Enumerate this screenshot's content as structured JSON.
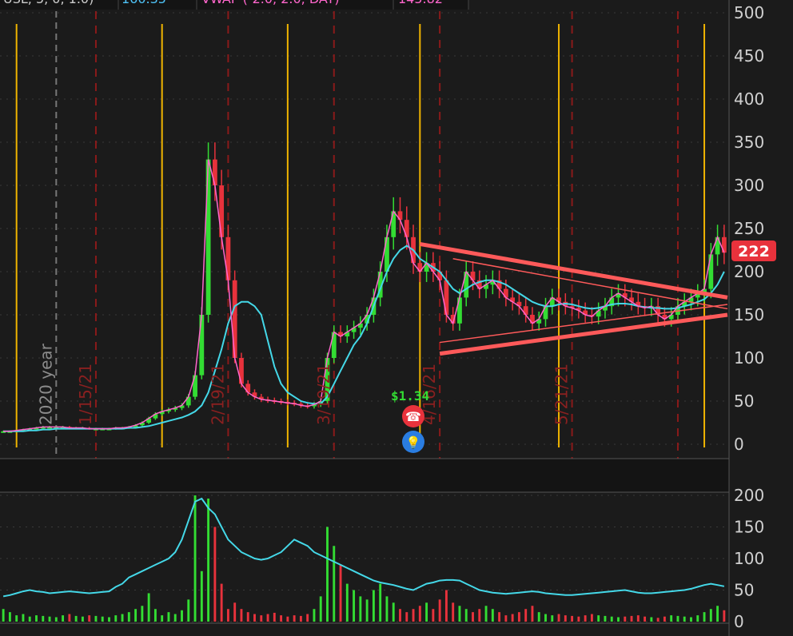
{
  "header": {
    "cells": [
      {
        "text": "USL, 5, 0, 1.0)",
        "color": "#cccccc"
      },
      {
        "text": "160.35",
        "color": "#4fc3f7"
      },
      {
        "text": "VWAP (-2.0, 2.0, DAY)",
        "color": "#ff66cc"
      },
      {
        "text": "145.82",
        "color": "#ff66cc"
      }
    ]
  },
  "price_tag": {
    "value": "222",
    "color": "#e8323c"
  },
  "events": {
    "dividend_label": "$1.34"
  },
  "colors": {
    "bg": "#1b1b1b",
    "grid": "#3a3a3a",
    "up": "#33dd33",
    "down": "#e8323c",
    "ma": "#44d8e8",
    "vwap": "#ff66cc",
    "trendline": "#ff5a5a",
    "vertical_marker": "#f0b400",
    "date_line": "#8a1a1a"
  },
  "chart_data": [
    {
      "type": "candlestick",
      "title": "",
      "ylim": [
        0,
        500
      ],
      "y_ticks": [
        0,
        50,
        100,
        150,
        200,
        250,
        300,
        350,
        400,
        450,
        500
      ],
      "date_labels": [
        "1/15/21",
        "2/19/21",
        "3/19/21",
        "4/16/21",
        "5/21/21"
      ],
      "year_label": "2020 year",
      "close": [
        15,
        15,
        16,
        17,
        18,
        19,
        20,
        20,
        20,
        20,
        19,
        19,
        19,
        18,
        18,
        18,
        18,
        19,
        19,
        20,
        22,
        25,
        30,
        35,
        38,
        40,
        42,
        45,
        55,
        80,
        150,
        330,
        300,
        240,
        190,
        100,
        70,
        60,
        55,
        52,
        51,
        50,
        49,
        48,
        47,
        45,
        44,
        46,
        50,
        100,
        130,
        125,
        130,
        135,
        140,
        150,
        170,
        200,
        240,
        270,
        260,
        240,
        210,
        200,
        210,
        200,
        190,
        150,
        140,
        170,
        200,
        190,
        180,
        185,
        190,
        180,
        170,
        165,
        160,
        150,
        140,
        145,
        160,
        170,
        165,
        160,
        158,
        155,
        150,
        148,
        155,
        160,
        170,
        175,
        170,
        165,
        160,
        158,
        160,
        150,
        145,
        150,
        160,
        165,
        170,
        175,
        180,
        220,
        240,
        222
      ],
      "ma": [
        15,
        15,
        15,
        15,
        16,
        16,
        17,
        17,
        18,
        18,
        18,
        18,
        18,
        18,
        18,
        18,
        18,
        18,
        18,
        19,
        19,
        20,
        21,
        23,
        25,
        27,
        29,
        31,
        34,
        38,
        45,
        60,
        85,
        110,
        140,
        160,
        165,
        165,
        160,
        150,
        120,
        90,
        70,
        60,
        55,
        50,
        48,
        47,
        47,
        55,
        70,
        85,
        100,
        115,
        125,
        140,
        160,
        180,
        200,
        215,
        225,
        230,
        225,
        215,
        210,
        205,
        200,
        190,
        180,
        175,
        180,
        185,
        188,
        190,
        190,
        188,
        185,
        180,
        175,
        170,
        165,
        162,
        160,
        160,
        162,
        163,
        162,
        160,
        158,
        157,
        158,
        160,
        162,
        163,
        163,
        162,
        160,
        159,
        158,
        158,
        157,
        157,
        158,
        160,
        162,
        165,
        168,
        175,
        185,
        200
      ],
      "vwap": [
        15,
        15,
        16,
        17,
        18,
        19,
        20,
        20,
        20,
        20,
        19,
        19,
        19,
        18,
        18,
        18,
        18,
        19,
        19,
        20,
        22,
        25,
        30,
        35,
        38,
        40,
        42,
        45,
        55,
        80,
        150,
        330,
        300,
        240,
        190,
        100,
        70,
        60,
        55,
        52,
        51,
        50,
        49,
        48,
        47,
        45,
        44,
        46,
        50,
        100,
        130,
        125,
        130,
        135,
        140,
        150,
        170,
        200,
        240,
        270,
        260,
        240,
        210,
        200,
        210,
        200,
        190,
        150,
        140,
        170,
        200,
        190,
        180,
        185,
        190,
        180,
        170,
        165,
        160,
        150,
        140,
        145,
        160,
        170,
        165,
        160,
        158,
        155,
        150,
        148,
        155,
        160,
        170,
        175,
        170,
        165,
        160,
        158,
        160,
        150,
        145,
        150,
        160,
        165,
        170,
        175,
        180,
        220,
        240,
        222
      ],
      "volume": [
        20,
        15,
        10,
        12,
        8,
        10,
        9,
        8,
        7,
        10,
        12,
        9,
        8,
        10,
        9,
        8,
        7,
        10,
        12,
        15,
        20,
        25,
        45,
        20,
        10,
        15,
        12,
        18,
        35,
        200,
        80,
        195,
        150,
        60,
        20,
        30,
        20,
        15,
        12,
        10,
        12,
        14,
        10,
        8,
        10,
        9,
        12,
        20,
        40,
        150,
        120,
        90,
        60,
        50,
        40,
        35,
        50,
        60,
        40,
        30,
        20,
        15,
        20,
        25,
        30,
        20,
        35,
        50,
        30,
        25,
        20,
        15,
        20,
        25,
        20,
        15,
        10,
        12,
        15,
        20,
        25,
        15,
        12,
        10,
        12,
        10,
        9,
        8,
        10,
        12,
        10,
        9,
        8,
        7,
        8,
        9,
        10,
        8,
        7,
        6,
        8,
        10,
        9,
        8,
        7,
        10,
        15,
        20,
        25,
        18
      ],
      "volume_ma": [
        40,
        42,
        45,
        48,
        50,
        48,
        47,
        45,
        46,
        47,
        48,
        47,
        46,
        45,
        46,
        47,
        48,
        55,
        60,
        70,
        75,
        80,
        85,
        90,
        95,
        100,
        110,
        130,
        160,
        190,
        195,
        180,
        170,
        150,
        130,
        120,
        110,
        105,
        100,
        98,
        100,
        105,
        110,
        120,
        130,
        125,
        120,
        110,
        105,
        100,
        95,
        90,
        85,
        80,
        75,
        70,
        65,
        62,
        60,
        58,
        55,
        52,
        50,
        55,
        60,
        62,
        65,
        66,
        66,
        65,
        60,
        55,
        50,
        48,
        46,
        45,
        44,
        45,
        46,
        47,
        48,
        47,
        45,
        44,
        43,
        42,
        42,
        43,
        44,
        45,
        46,
        47,
        48,
        49,
        50,
        48,
        46,
        45,
        45,
        46,
        47,
        48,
        49,
        50,
        52,
        55,
        58,
        60,
        58,
        56
      ],
      "vol_ylim": [
        0,
        200
      ],
      "vol_ticks": [
        0,
        50,
        100,
        150,
        200
      ]
    }
  ]
}
